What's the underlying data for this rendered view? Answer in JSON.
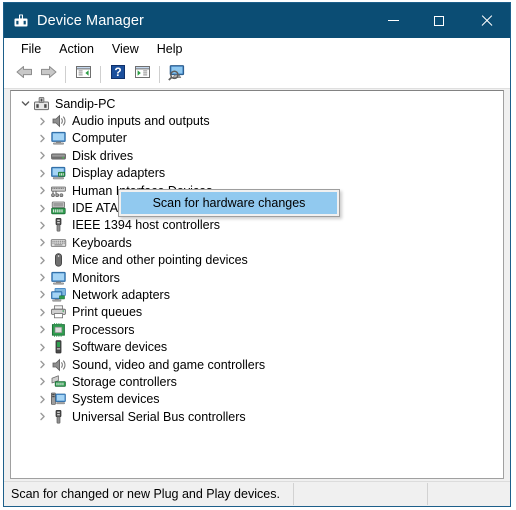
{
  "window": {
    "title": "Device Manager",
    "title_icon": "device-manager-icon",
    "accent_titlebar": "#0b4d74",
    "caption": {
      "minimize": "─",
      "maximize": "□",
      "close": "✕"
    }
  },
  "menubar": {
    "items": [
      {
        "label": "File"
      },
      {
        "label": "Action"
      },
      {
        "label": "View"
      },
      {
        "label": "Help"
      }
    ]
  },
  "toolbar": {
    "buttons": [
      {
        "icon": "back-arrow-icon",
        "label": "Back"
      },
      {
        "icon": "forward-arrow-icon",
        "label": "Forward"
      },
      {
        "icon": "separator"
      },
      {
        "icon": "properties-icon",
        "label": "Properties"
      },
      {
        "icon": "separator"
      },
      {
        "icon": "help-icon",
        "label": "Help"
      },
      {
        "icon": "show-hidden-devices-icon",
        "label": "Show hidden devices"
      },
      {
        "icon": "separator"
      },
      {
        "icon": "scan-hardware-changes-icon",
        "label": "Scan for hardware changes"
      }
    ]
  },
  "tree": {
    "root": {
      "label": "Sandip-PC",
      "icon": "computer-root-icon",
      "expanded": true
    },
    "items": [
      {
        "label": "Audio inputs and outputs",
        "icon": "speaker-icon"
      },
      {
        "label": "Computer",
        "icon": "monitor-icon"
      },
      {
        "label": "Disk drives",
        "icon": "disk-drive-icon"
      },
      {
        "label": "Display adapters",
        "icon": "display-adapter-icon"
      },
      {
        "label": "Human Interface Devices",
        "icon": "gamepad-icon"
      },
      {
        "label": "IDE ATA/ATAPI controllers",
        "icon": "ide-controller-icon"
      },
      {
        "label": "IEEE 1394 host controllers",
        "icon": "plug-icon"
      },
      {
        "label": "Keyboards",
        "icon": "keyboard-icon"
      },
      {
        "label": "Mice and other pointing devices",
        "icon": "mouse-icon"
      },
      {
        "label": "Monitors",
        "icon": "monitor-icon"
      },
      {
        "label": "Network adapters",
        "icon": "network-adapter-icon"
      },
      {
        "label": "Print queues",
        "icon": "printer-icon"
      },
      {
        "label": "Processors",
        "icon": "processor-icon"
      },
      {
        "label": "Software devices",
        "icon": "software-device-icon"
      },
      {
        "label": "Sound, video and game controllers",
        "icon": "speaker-icon"
      },
      {
        "label": "Storage controllers",
        "icon": "storage-controller-icon"
      },
      {
        "label": "System devices",
        "icon": "system-device-icon"
      },
      {
        "label": "Universal Serial Bus controllers",
        "icon": "usb-icon"
      }
    ]
  },
  "context_menu": {
    "highlight_color": "#91c9ef",
    "items": [
      {
        "label": "Scan for hardware changes",
        "selected": true
      }
    ]
  },
  "statusbar": {
    "text": "Scan for changed or new Plug and Play devices."
  }
}
